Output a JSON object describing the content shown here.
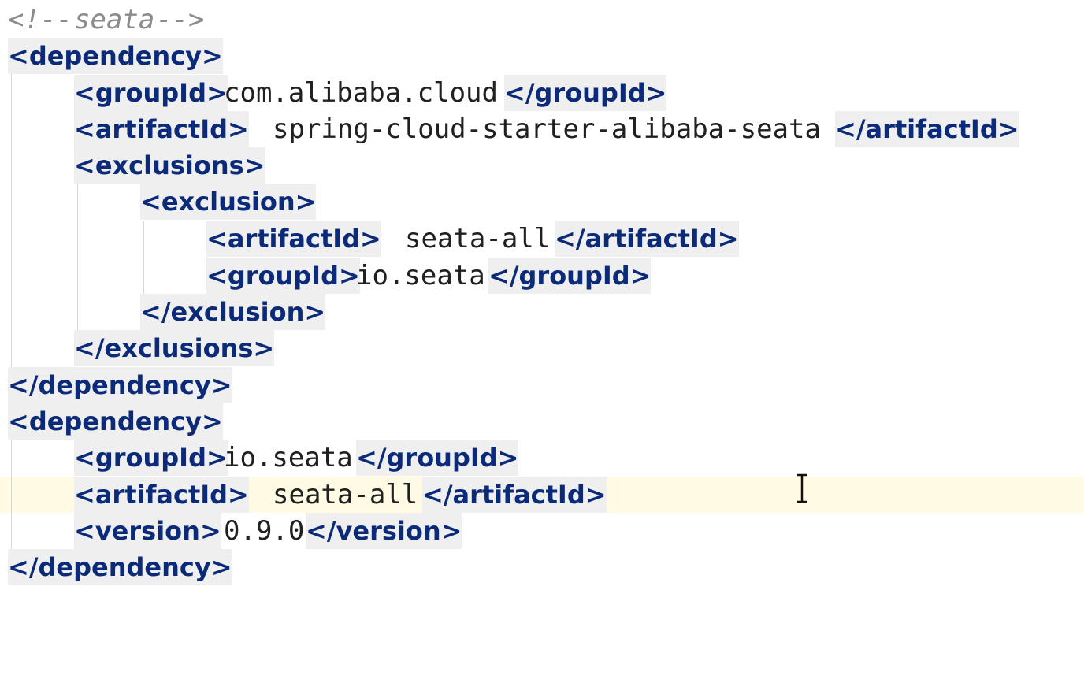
{
  "editor": {
    "lines": [
      {
        "segments": [
          {
            "kind": "comment",
            "text": "<!--"
          },
          {
            "kind": "comment-word",
            "text": "seata"
          },
          {
            "kind": "comment",
            "text": "-->"
          }
        ]
      },
      {
        "segments": [
          {
            "kind": "tag",
            "text": "<dependency>"
          }
        ]
      },
      {
        "segments": [
          {
            "kind": "tag",
            "text": "<groupId>"
          },
          {
            "kind": "text",
            "text": "com.alibaba.cloud"
          },
          {
            "kind": "tag",
            "text": "</groupId>"
          }
        ]
      },
      {
        "segments": [
          {
            "kind": "tag",
            "text": "<artifactId>"
          },
          {
            "kind": "text",
            "text": "spring-cloud-starter-alibaba-seata"
          },
          {
            "kind": "tag",
            "text": "</artifactId>"
          }
        ]
      },
      {
        "segments": [
          {
            "kind": "tag",
            "text": "<exclusions>"
          }
        ]
      },
      {
        "segments": [
          {
            "kind": "tag",
            "text": "<exclusion>"
          }
        ]
      },
      {
        "segments": [
          {
            "kind": "tag",
            "text": "<artifactId>"
          },
          {
            "kind": "text",
            "text": "seata-all"
          },
          {
            "kind": "tag",
            "text": "</artifactId>"
          }
        ]
      },
      {
        "segments": [
          {
            "kind": "tag",
            "text": "<groupId>"
          },
          {
            "kind": "text",
            "text": "io.seata"
          },
          {
            "kind": "tag",
            "text": "</groupId>"
          }
        ]
      },
      {
        "segments": [
          {
            "kind": "tag",
            "text": "</exclusion>"
          }
        ]
      },
      {
        "segments": [
          {
            "kind": "tag",
            "text": "</exclusions>"
          }
        ]
      },
      {
        "segments": [
          {
            "kind": "tag",
            "text": "</dependency>"
          }
        ]
      },
      {
        "segments": [
          {
            "kind": "tag",
            "text": "<dependency>"
          }
        ]
      },
      {
        "segments": [
          {
            "kind": "tag",
            "text": "<groupId>"
          },
          {
            "kind": "text",
            "text": "io.seata"
          },
          {
            "kind": "tag",
            "text": "</groupId>"
          }
        ]
      },
      {
        "segments": [
          {
            "kind": "tag",
            "text": "<artifactId>"
          },
          {
            "kind": "text",
            "text": "seata-all"
          },
          {
            "kind": "tag",
            "text": "</artifactId>"
          }
        ]
      },
      {
        "segments": [
          {
            "kind": "tag",
            "text": "<version>"
          },
          {
            "kind": "text",
            "text": "0.9.0"
          },
          {
            "kind": "tag",
            "text": "</version>"
          }
        ]
      },
      {
        "segments": [
          {
            "kind": "tag",
            "text": "</dependency>"
          }
        ]
      }
    ],
    "colors": {
      "tag": "#0b2a78",
      "text": "#202020",
      "comment": "#8c8c8c",
      "current_line": "#fffae3",
      "tag_bg": "#efefef"
    }
  }
}
